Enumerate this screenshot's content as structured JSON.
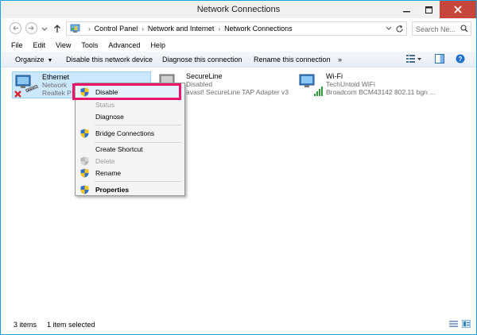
{
  "window": {
    "title": "Network Connections"
  },
  "address": {
    "crumbs": [
      "Control Panel",
      "Network and Internet",
      "Network Connections"
    ],
    "search_placeholder": "Search Ne..."
  },
  "menu": [
    "File",
    "Edit",
    "View",
    "Tools",
    "Advanced",
    "Help"
  ],
  "commands": {
    "organize": "Organize",
    "disable": "Disable this network device",
    "diagnose": "Diagnose this connection",
    "rename": "Rename this connection",
    "more": "»"
  },
  "connections": [
    {
      "name": "Ethernet",
      "status": "Network",
      "adapter": "Realtek P"
    },
    {
      "name": "SecureLine",
      "status": "Disabled",
      "adapter": "avast! SecureLine TAP Adapter v3"
    },
    {
      "name": "Wi-Fi",
      "status": "TechUntold WiFi",
      "adapter": "Broadcom BCM43142 802.11 bgn ..."
    }
  ],
  "context_menu": {
    "disable": "Disable",
    "status": "Status",
    "diagnose": "Diagnose",
    "bridge": "Bridge Connections",
    "shortcut": "Create Shortcut",
    "delete": "Delete",
    "rename": "Rename",
    "properties": "Properties"
  },
  "statusbar": {
    "count": "3 items",
    "selected": "1 item selected"
  },
  "colors": {
    "highlight": "#e9166c",
    "selection": "#cce8ff",
    "close_button": "#c7463b",
    "window_border": "#1ba1e2"
  }
}
